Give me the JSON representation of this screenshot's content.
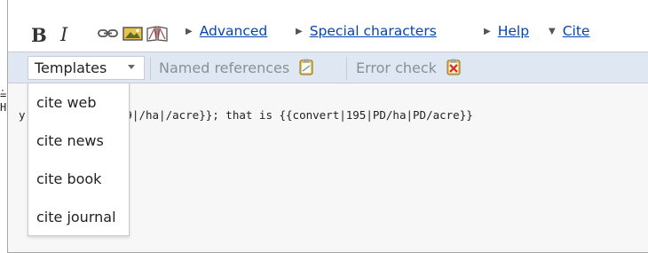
{
  "left_edge": {
    "line1": "=",
    "line2": "H",
    "mark": "·"
  },
  "toolbar": {
    "bold_label": "B",
    "italic_label": "I",
    "icons": [
      "link-icon",
      "image-icon",
      "reference-book-icon"
    ]
  },
  "tabs": {
    "advanced": "Advanced",
    "special_characters": "Special characters",
    "help": "Help",
    "cite": "Cite"
  },
  "cite_toolbar": {
    "templates_label": "Templates",
    "named_references": "Named references",
    "error_check": "Error check"
  },
  "editor": {
    "code_text": "y of {{convert|39|/ha|/acre}}; that is {{convert|195|PD/ha|PD/acre}}"
  },
  "dropdown": {
    "items": [
      {
        "label": "cite web"
      },
      {
        "label": "cite news"
      },
      {
        "label": "cite book"
      },
      {
        "label": "cite journal"
      }
    ]
  },
  "colors": {
    "link": "#0645ad",
    "toolbar_bg": "#dfe8f2",
    "editor_bg": "#f7f7f7",
    "border": "#a7a7a7"
  }
}
